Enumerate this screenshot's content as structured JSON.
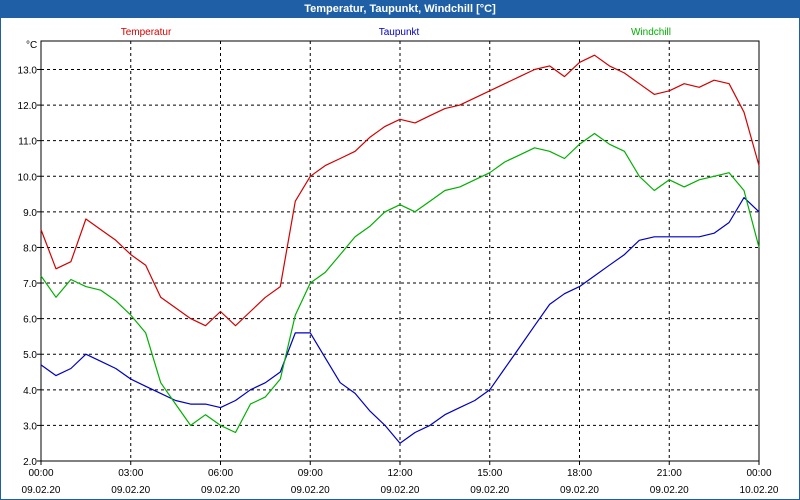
{
  "window": {
    "title": "Temperatur, Taupunkt, Windchill [°C]"
  },
  "chart_data": {
    "type": "line",
    "title": "Temperatur, Taupunkt, Windchill [°C]",
    "ylabel": "°C",
    "ylim": [
      2.0,
      13.8
    ],
    "yticks": [
      "2.0",
      "3.0",
      "4.0",
      "5.0",
      "6.0",
      "7.0",
      "8.0",
      "9.0",
      "10.0",
      "11.0",
      "12.0",
      "13.0"
    ],
    "xlim": [
      "2020-02-09 00:00",
      "2020-02-10 00:00"
    ],
    "xticks": [
      {
        "time": "00:00",
        "date": "09.02.20"
      },
      {
        "time": "03:00",
        "date": "09.02.20"
      },
      {
        "time": "06:00",
        "date": "09.02.20"
      },
      {
        "time": "09:00",
        "date": "09.02.20"
      },
      {
        "time": "12:00",
        "date": "09.02.20"
      },
      {
        "time": "15:00",
        "date": "09.02.20"
      },
      {
        "time": "18:00",
        "date": "09.02.20"
      },
      {
        "time": "21:00",
        "date": "09.02.20"
      },
      {
        "time": "00:00",
        "date": "10.02.20"
      }
    ],
    "grid": true,
    "legend_position": "top",
    "x_times": [
      "00:00",
      "00:30",
      "01:00",
      "01:30",
      "02:00",
      "02:30",
      "03:00",
      "03:30",
      "04:00",
      "04:30",
      "05:00",
      "05:30",
      "06:00",
      "06:30",
      "07:00",
      "07:30",
      "08:00",
      "08:30",
      "09:00",
      "09:30",
      "10:00",
      "10:30",
      "11:00",
      "11:30",
      "12:00",
      "12:30",
      "13:00",
      "13:30",
      "14:00",
      "14:30",
      "15:00",
      "15:30",
      "16:00",
      "16:30",
      "17:00",
      "17:30",
      "18:00",
      "18:30",
      "19:00",
      "19:30",
      "20:00",
      "20:30",
      "21:00",
      "21:30",
      "22:00",
      "22:30",
      "23:00",
      "23:30",
      "24:00"
    ],
    "series": [
      {
        "name": "Temperatur",
        "color": "#d40000",
        "values": [
          8.5,
          7.4,
          7.6,
          8.8,
          8.5,
          8.2,
          7.8,
          7.5,
          6.6,
          6.3,
          6.0,
          5.8,
          6.2,
          5.8,
          6.2,
          6.6,
          6.9,
          9.3,
          10.0,
          10.3,
          10.5,
          10.7,
          11.1,
          11.4,
          11.6,
          11.5,
          11.7,
          11.9,
          12.0,
          12.2,
          12.4,
          12.6,
          12.8,
          13.0,
          13.1,
          12.8,
          13.2,
          13.4,
          13.1,
          12.9,
          12.6,
          12.3,
          12.4,
          12.6,
          12.5,
          12.7,
          12.6,
          11.8,
          10.3
        ]
      },
      {
        "name": "Taupunkt",
        "color": "#0000c0",
        "values": [
          4.7,
          4.4,
          4.6,
          5.0,
          4.8,
          4.6,
          4.3,
          4.1,
          3.9,
          3.7,
          3.6,
          3.6,
          3.5,
          3.7,
          4.0,
          4.2,
          4.5,
          5.6,
          5.6,
          4.9,
          4.2,
          3.9,
          3.4,
          3.0,
          2.5,
          2.8,
          3.0,
          3.3,
          3.5,
          3.7,
          4.0,
          4.6,
          5.2,
          5.8,
          6.4,
          6.7,
          6.9,
          7.2,
          7.5,
          7.8,
          8.2,
          8.3,
          8.3,
          8.3,
          8.3,
          8.4,
          8.7,
          9.4,
          9.0
        ]
      },
      {
        "name": "Windchill",
        "color": "#00b000",
        "values": [
          7.2,
          6.6,
          7.1,
          6.9,
          6.8,
          6.5,
          6.1,
          5.6,
          4.2,
          3.6,
          3.0,
          3.3,
          3.0,
          2.8,
          3.6,
          3.8,
          4.3,
          6.1,
          7.0,
          7.3,
          7.8,
          8.3,
          8.6,
          9.0,
          9.2,
          9.0,
          9.3,
          9.6,
          9.7,
          9.9,
          10.1,
          10.4,
          10.6,
          10.8,
          10.7,
          10.5,
          10.9,
          11.2,
          10.9,
          10.7,
          10.0,
          9.6,
          9.9,
          9.7,
          9.9,
          10.0,
          10.1,
          9.6,
          8.0
        ]
      }
    ]
  }
}
